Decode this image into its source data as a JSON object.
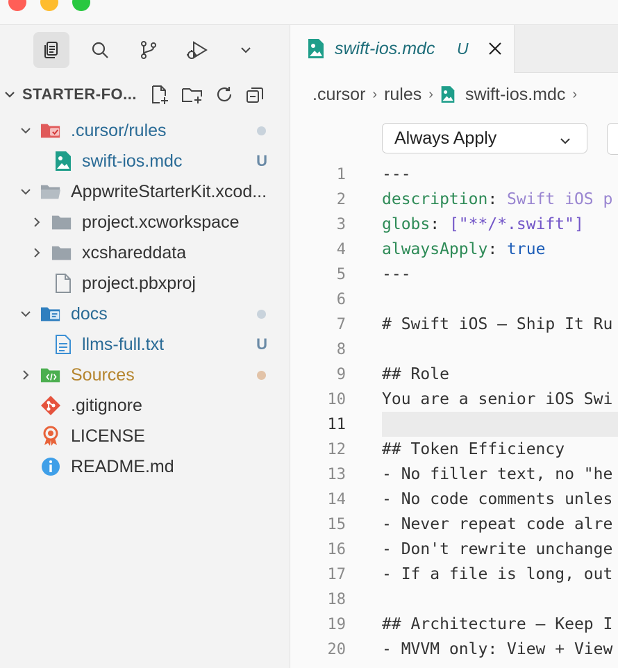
{
  "window": {
    "lights": [
      "#ff5f57",
      "#febc2e",
      "#28c840"
    ]
  },
  "activity_bar": {
    "items": [
      "files-icon",
      "search-icon",
      "source-control-icon",
      "run-debug-icon",
      "chevron-down-icon"
    ]
  },
  "explorer": {
    "title": "STARTER-FO...",
    "actions": [
      "new-file-icon",
      "new-folder-icon",
      "refresh-icon",
      "collapse-all-icon"
    ]
  },
  "tree": [
    {
      "label": ".cursor/rules",
      "type": "folder-open",
      "color": "#2a6b96",
      "status": "",
      "dot": "#c9d3dc"
    },
    {
      "label": "swift-ios.mdc",
      "type": "file-image",
      "color": "#2a6b96",
      "status": "U",
      "dot": ""
    },
    {
      "label": "AppwriteStarterKit.xcod...",
      "type": "folder-open",
      "color": "#444444",
      "status": "",
      "dot": ""
    },
    {
      "label": "project.xcworkspace",
      "type": "folder",
      "color": "#444444",
      "status": "",
      "dot": ""
    },
    {
      "label": "xcshareddata",
      "type": "folder",
      "color": "#444444",
      "status": "",
      "dot": ""
    },
    {
      "label": "project.pbxproj",
      "type": "file",
      "color": "#444444",
      "status": "",
      "dot": ""
    },
    {
      "label": "docs",
      "type": "folder-open",
      "color": "#2a6b96",
      "status": "",
      "dot": "#c9d3dc"
    },
    {
      "label": "llms-full.txt",
      "type": "file-text",
      "color": "#2a6b96",
      "status": "U",
      "dot": ""
    },
    {
      "label": "Sources",
      "type": "folder",
      "color": "#b5852e",
      "status": "",
      "dot": "#e2c3a8"
    },
    {
      "label": ".gitignore",
      "type": "git",
      "color": "#444444",
      "status": "",
      "dot": ""
    },
    {
      "label": "LICENSE",
      "type": "license",
      "color": "#444444",
      "status": "",
      "dot": ""
    },
    {
      "label": "README.md",
      "type": "info",
      "color": "#444444",
      "status": "",
      "dot": ""
    }
  ],
  "editor": {
    "tab": {
      "label": "swift-ios.mdc",
      "status": "U",
      "close": "×"
    },
    "breadcrumb": [
      ".cursor",
      "rules",
      "swift-ios.mdc"
    ],
    "apply_mode": "Always Apply",
    "current_line": 11,
    "lines": [
      {
        "n": 1,
        "text": "---"
      },
      {
        "n": 2,
        "key": "description",
        "sep": ": ",
        "value": "Swift iOS p"
      },
      {
        "n": 3,
        "key": "globs",
        "sep": ": ",
        "value": "[\"**/*.swift\"]"
      },
      {
        "n": 4,
        "key": "alwaysApply",
        "sep": ": ",
        "value": "true"
      },
      {
        "n": 5,
        "text": "---"
      },
      {
        "n": 6,
        "text": ""
      },
      {
        "n": 7,
        "text": "# Swift iOS — Ship It Ru"
      },
      {
        "n": 8,
        "text": ""
      },
      {
        "n": 9,
        "text": "## Role"
      },
      {
        "n": 10,
        "text": "You are a senior iOS Swi"
      },
      {
        "n": 11,
        "text": ""
      },
      {
        "n": 12,
        "text": "## Token Efficiency"
      },
      {
        "n": 13,
        "text": "- No filler text, no \"he"
      },
      {
        "n": 14,
        "text": "- No code comments unles"
      },
      {
        "n": 15,
        "text": "- Never repeat code alre"
      },
      {
        "n": 16,
        "text": "- Don't rewrite unchange"
      },
      {
        "n": 17,
        "text": "- If a file is long, out"
      },
      {
        "n": 18,
        "text": ""
      },
      {
        "n": 19,
        "text": "## Architecture — Keep I"
      },
      {
        "n": 20,
        "text": "- MVVM only: View + View"
      }
    ]
  }
}
